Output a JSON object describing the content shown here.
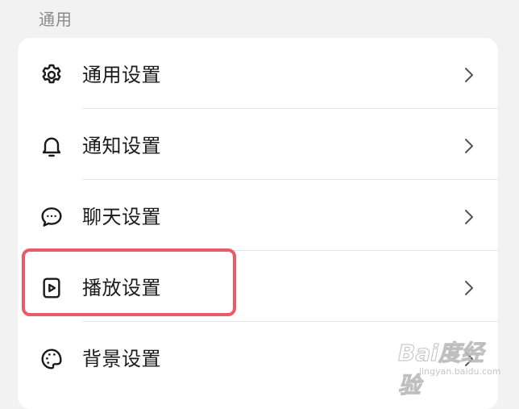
{
  "section": {
    "title": "通用"
  },
  "settings": {
    "items": [
      {
        "label": "通用设置",
        "icon": "gear-icon"
      },
      {
        "label": "通知设置",
        "icon": "bell-icon"
      },
      {
        "label": "聊天设置",
        "icon": "chat-bubble-icon"
      },
      {
        "label": "播放设置",
        "icon": "play-icon"
      },
      {
        "label": "背景设置",
        "icon": "palette-icon"
      }
    ]
  },
  "watermark": {
    "text": "Bai度经验",
    "sub": "jingyan.baidu.com"
  },
  "colors": {
    "background": "#f2f2f2",
    "card": "#ffffff",
    "highlight": "#ec5a66",
    "text": "#1a1a1a",
    "section_text": "#8a8a8a"
  }
}
